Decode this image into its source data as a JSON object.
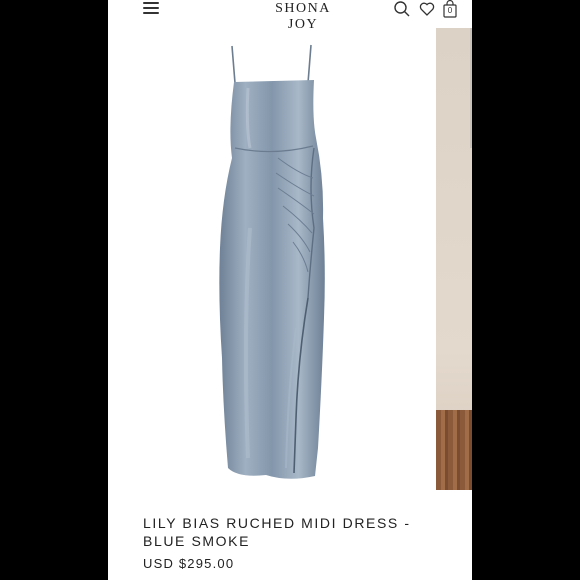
{
  "header": {
    "brand": "SHONA JOY",
    "bag_count": "0",
    "icons": [
      "menu-icon",
      "search-icon",
      "heart-icon",
      "bag-icon"
    ]
  },
  "product": {
    "title": "LILY BIAS RUCHED MIDI DRESS - BLUE SMOKE",
    "price": "USD $295.00",
    "image_alt": "dress-photo",
    "dress_color": "#8a9cb0"
  },
  "colors": {
    "background": "#000000",
    "screen": "#ffffff",
    "text": "#222222"
  }
}
